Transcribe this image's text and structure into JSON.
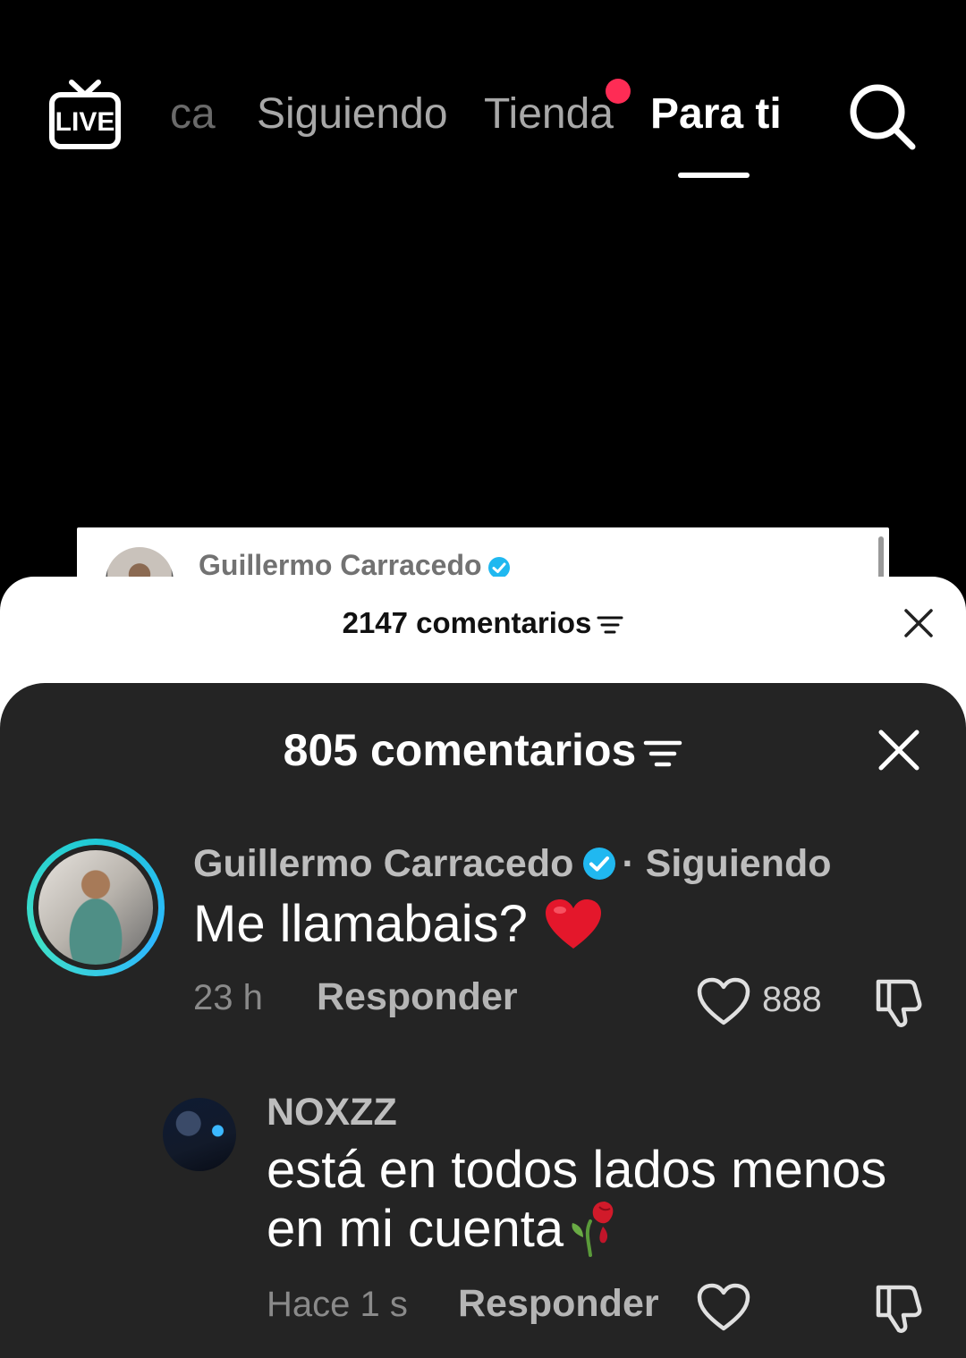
{
  "top_nav": {
    "tabs": [
      {
        "label": "ca",
        "state": "partial"
      },
      {
        "label": "Siguiendo",
        "state": "inactive"
      },
      {
        "label": "Tienda",
        "state": "inactive",
        "has_notification_dot": true
      },
      {
        "label": "Para ti",
        "state": "active"
      }
    ],
    "live_icon": "live-tv-icon",
    "search_icon": "search-icon",
    "notification_dot_color": "#fe2c55"
  },
  "background_post": {
    "author": "Guillermo Carracedo",
    "verified": true
  },
  "outer_sheet": {
    "count_label": "2147 comentarios",
    "filter_icon": "filter-icon",
    "close_icon": "close-icon"
  },
  "inner_sheet": {
    "count_label": "805 comentarios",
    "filter_icon": "filter-icon",
    "close_icon": "close-icon",
    "comments": [
      {
        "author": "Guillermo Carracedo",
        "verified": true,
        "separator": "·",
        "follow_status": "Siguiendo",
        "text": "Me llamabais?",
        "emoji": "red-heart",
        "time": "23 h",
        "reply_label": "Responder",
        "likes": "888"
      },
      {
        "author": "NOXZZ",
        "text": "está en todos lados menos en mi cuenta",
        "emoji": "wilted-rose",
        "time": "Hace 1 s",
        "reply_label": "Responder"
      }
    ]
  },
  "colors": {
    "background": "#000000",
    "sheet_dark": "#242424",
    "sheet_light": "#ffffff",
    "verified_blue": "#20b8f0",
    "story_ring": "#1fc9d6"
  }
}
